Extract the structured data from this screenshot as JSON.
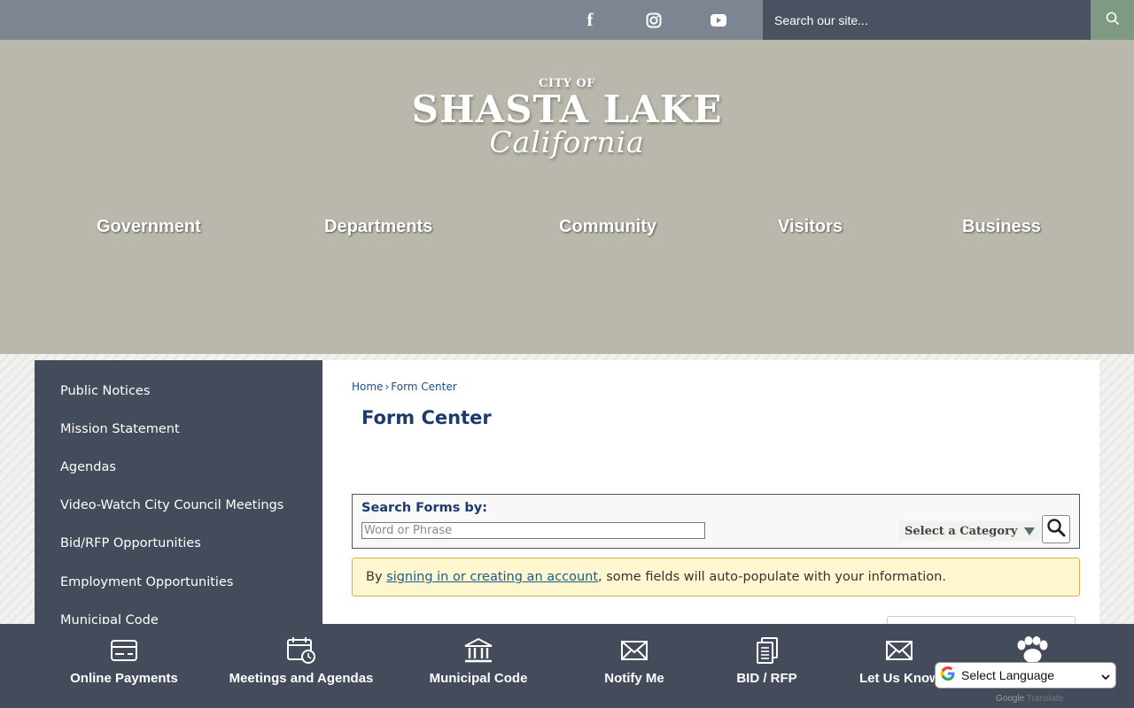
{
  "topbar": {
    "social": [
      {
        "icon": "facebook-icon",
        "glyph": "f"
      },
      {
        "icon": "instagram-icon"
      },
      {
        "icon": "youtube-icon"
      }
    ],
    "search_placeholder": "Search our site...",
    "search_icon": "search-icon"
  },
  "header": {
    "logo": {
      "city_of": "CITY OF",
      "name": "SHASTA LAKE",
      "state": "California"
    },
    "nav": [
      "Government",
      "Departments",
      "Community",
      "Visitors",
      "Business"
    ]
  },
  "sidebar": {
    "items": [
      "Public Notices",
      "Mission Statement",
      "Agendas",
      "Video-Watch City Council Meetings",
      "Bid/RFP Opportunities",
      "Employment Opportunities",
      "Municipal Code"
    ]
  },
  "main": {
    "breadcrumb": {
      "home": "Home",
      "separator": "›",
      "current": "Form Center"
    },
    "title": "Form Center",
    "search": {
      "label": "Search Forms by:",
      "input_placeholder": "Word or Phrase",
      "category_label": "Select a Category"
    },
    "notice": {
      "prefix": "By ",
      "link": "signing in or creating an account",
      "suffix": ", some fields will auto-populate with your information."
    }
  },
  "quicklinks": [
    {
      "label": "Online Payments",
      "icon": "credit-card-icon"
    },
    {
      "label": "Meetings and Agendas",
      "icon": "calendar-clock-icon"
    },
    {
      "label": "Municipal Code",
      "icon": "courthouse-icon"
    },
    {
      "label": "Notify Me",
      "icon": "envelope-icon"
    },
    {
      "label": "BID / RFP",
      "icon": "documents-icon"
    },
    {
      "label": "Let Us Know",
      "icon": "envelope-icon"
    },
    {
      "label": "",
      "icon": "paw-icon"
    }
  ],
  "translate": {
    "label": "Select Language",
    "powered_by": "Google",
    "translate_word": "Translate"
  },
  "colors": {
    "topbar": "#7d8592",
    "search_bg": "#4a5160",
    "search_btn": "#7f9a83",
    "header": "#bab8ad",
    "sidebar": "#444b5a",
    "title": "#1c3a6e",
    "notice_bg": "#fdf6cf",
    "notice_border": "#d6b04c"
  }
}
